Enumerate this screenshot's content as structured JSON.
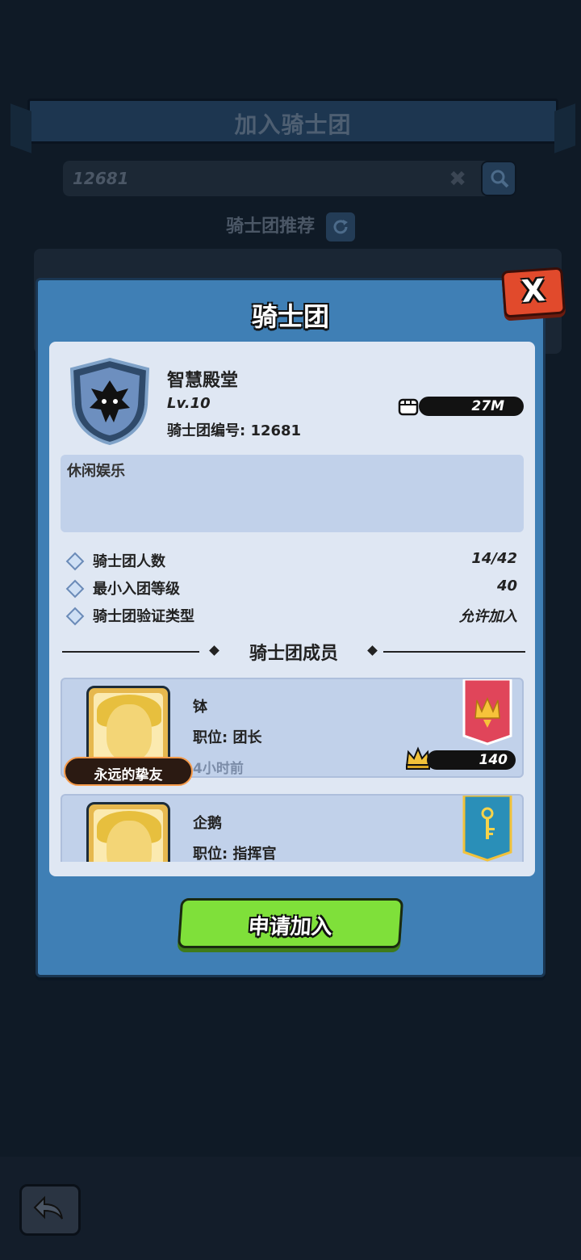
{
  "background": {
    "banner_title": "加入骑士团",
    "search_value": "12681",
    "recommend_label": "骑士团推荐"
  },
  "modal": {
    "title": "骑士团",
    "close_label": "X",
    "guild": {
      "name": "智慧殿堂",
      "level": "Lv.10",
      "id_label": "骑士团编号: 12681",
      "power": "27M",
      "description": "休闲娱乐"
    },
    "info": [
      {
        "label": "骑士团人数",
        "value": "14/42"
      },
      {
        "label": "最小入团等级",
        "value": "40"
      },
      {
        "label": "骑士团验证类型",
        "value": "允许加入"
      }
    ],
    "members_title": "骑士团成员",
    "members": [
      {
        "name": "钵",
        "role": "职位: 团长",
        "last_seen": "4小时前",
        "level": "140",
        "badge": "永远的挚友",
        "flag_color": "#e0455a"
      },
      {
        "name": "企鹅",
        "role": "职位: 指挥官",
        "flag_color": "#2a8fb8"
      }
    ],
    "apply_label": "申请加入"
  }
}
